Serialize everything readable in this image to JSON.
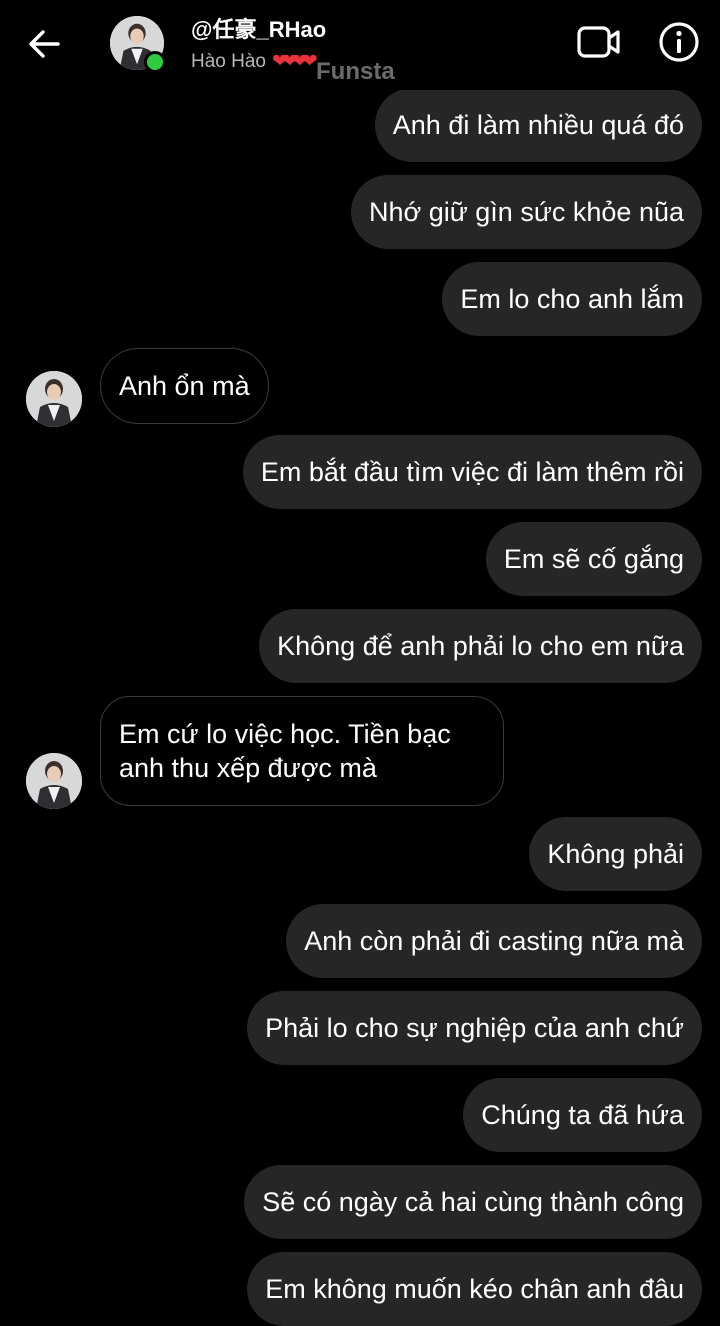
{
  "header": {
    "username": "@任豪_RHao",
    "status_name": "Hào Hào",
    "status_hearts": "❤❤❤❤",
    "watermark": "Funsta"
  },
  "colors": {
    "background": "#000000",
    "sent_bubble": "#262626",
    "received_border": "#3a3a3a",
    "online": "#2ecc40",
    "hearts": "#e8323c"
  },
  "icons": {
    "back": "arrow-left-icon",
    "video": "video-camera-icon",
    "info": "info-circle-icon"
  },
  "messages": [
    {
      "from": "me",
      "text": "Anh đi làm nhiều quá đó"
    },
    {
      "from": "me",
      "text": "Nhớ giữ gìn sức khỏe nũa"
    },
    {
      "from": "me",
      "text": "Em lo cho anh lắm"
    },
    {
      "from": "them",
      "text": "Anh ổn mà"
    },
    {
      "from": "me",
      "text": "Em bắt đầu tìm việc đi làm thêm rồi"
    },
    {
      "from": "me",
      "text": "Em sẽ cố gắng"
    },
    {
      "from": "me",
      "text": "Không để anh phải lo cho em nữa"
    },
    {
      "from": "them",
      "text": "Em cứ lo việc học. Tiền bạc anh thu xếp được mà"
    },
    {
      "from": "me",
      "text": "Không phải"
    },
    {
      "from": "me",
      "text": "Anh còn phải đi casting nữa mà"
    },
    {
      "from": "me",
      "text": "Phải lo cho sự nghiệp của anh chứ"
    },
    {
      "from": "me",
      "text": "Chúng ta đã hứa"
    },
    {
      "from": "me",
      "text": "Sẽ có ngày cả hai cùng thành công"
    },
    {
      "from": "me",
      "text": "Em không muốn kéo chân anh đâu"
    }
  ]
}
